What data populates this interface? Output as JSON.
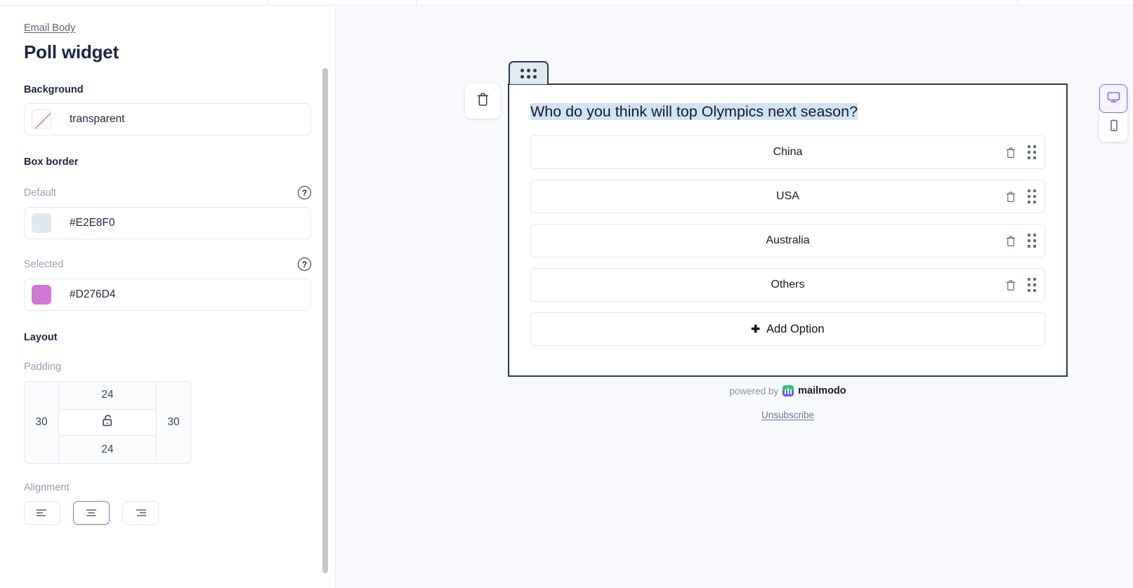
{
  "left_panel": {
    "breadcrumb": "Email Body",
    "title": "Poll widget",
    "background": {
      "section_label": "Background",
      "value": "transparent",
      "swatch_icon": "transparent-swatch-icon"
    },
    "box_border": {
      "section_label": "Box border",
      "default": {
        "label": "Default",
        "value": "#E2E8F0",
        "color": "#E2E8F0",
        "help_icon": "question-mark-icon"
      },
      "selected": {
        "label": "Selected",
        "value": "#D276D4",
        "color": "#D276D4",
        "help_icon": "question-mark-icon"
      }
    },
    "layout": {
      "section_label": "Layout",
      "padding_label": "Padding",
      "padding": {
        "top": "24",
        "bottom": "24",
        "left": "30",
        "right": "30",
        "lock_icon": "unlocked-padlock-icon"
      },
      "alignment_label": "Alignment",
      "alignment_options": [
        "align-left",
        "align-center",
        "align-right"
      ],
      "alignment_selected_index": 1
    }
  },
  "canvas": {
    "delete_button_icon": "trash-icon",
    "drag_handle_icon": "six-dots-drag-icon",
    "poll": {
      "question": "Who do you think will top Olympics next season?",
      "options": [
        {
          "label": "China",
          "delete_icon": "trash-icon",
          "drag_icon": "grip-dots-icon"
        },
        {
          "label": "USA",
          "delete_icon": "trash-icon",
          "drag_icon": "grip-dots-icon"
        },
        {
          "label": "Australia",
          "delete_icon": "trash-icon",
          "drag_icon": "grip-dots-icon"
        },
        {
          "label": "Others",
          "delete_icon": "trash-icon",
          "drag_icon": "grip-dots-icon"
        }
      ],
      "add_option_label": "Add Option",
      "add_option_icon": "plus-icon"
    },
    "footer": {
      "powered_by": "powered by",
      "brand": "mailmodo",
      "brand_logo_icon": "mailmodo-logo-icon",
      "unsubscribe": "Unsubscribe"
    }
  },
  "device_switcher": {
    "desktop_icon": "desktop-monitor-icon",
    "mobile_icon": "mobile-phone-icon",
    "active": "desktop"
  }
}
